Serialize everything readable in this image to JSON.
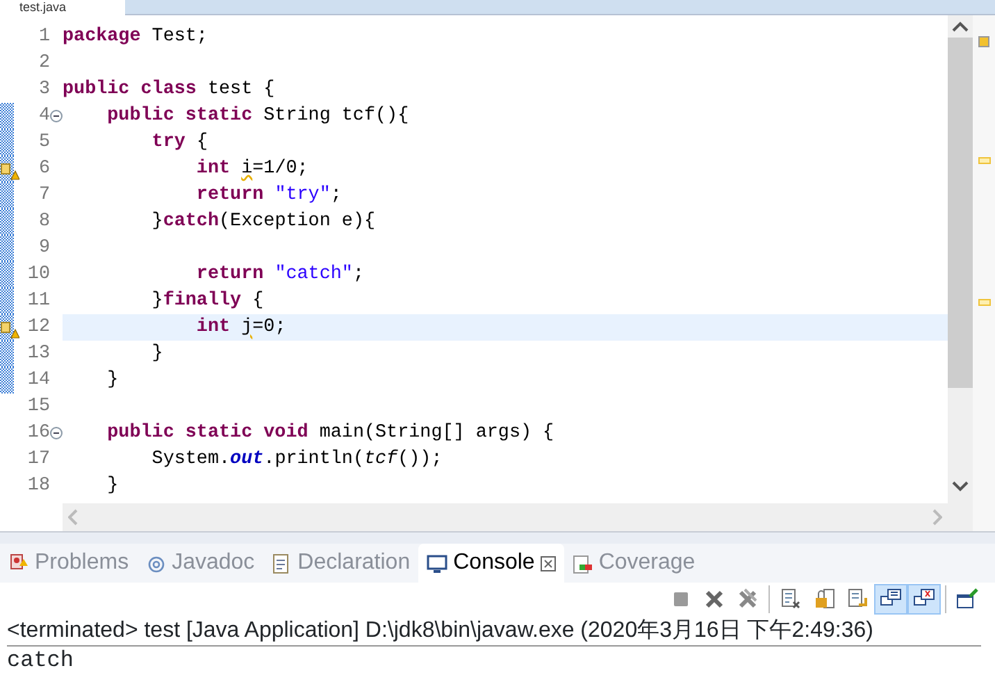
{
  "editor": {
    "tab": {
      "label": "test.java"
    },
    "lines": [
      {
        "number": "1",
        "changed": false,
        "current": false,
        "folding": false,
        "warning": false,
        "tokens": [
          {
            "kind": "kw",
            "text": "package"
          },
          {
            "kind": "plain",
            "text": " Test;"
          }
        ]
      },
      {
        "number": "2",
        "changed": false,
        "current": false,
        "folding": false,
        "warning": false
      },
      {
        "number": "3",
        "changed": false,
        "current": false,
        "folding": false,
        "warning": false,
        "tokens": [
          {
            "kind": "kw",
            "text": "public class"
          },
          {
            "kind": "plain",
            "text": " test {"
          }
        ]
      },
      {
        "number": "4",
        "changed": true,
        "current": false,
        "folding": true,
        "warning": false,
        "tokens": [
          {
            "kind": "kw",
            "text": "    public static"
          },
          {
            "kind": "plain",
            "text": " String tcf(){"
          }
        ]
      },
      {
        "number": "5",
        "changed": true,
        "current": false,
        "folding": false,
        "warning": false,
        "tokens": [
          {
            "kind": "kw",
            "text": "        try"
          },
          {
            "kind": "plain",
            "text": " {"
          }
        ]
      },
      {
        "number": "6",
        "changed": true,
        "current": false,
        "folding": false,
        "warning": true,
        "tokens": [
          {
            "kind": "kw",
            "text": "            int "
          },
          {
            "kind": "warn",
            "text": "i"
          },
          {
            "kind": "plain",
            "text": "=1/0;"
          }
        ]
      },
      {
        "number": "7",
        "changed": true,
        "current": false,
        "folding": false,
        "warning": false,
        "tokens": [
          {
            "kind": "kw",
            "text": "            return "
          },
          {
            "kind": "str",
            "text": "\"try\""
          },
          {
            "kind": "plain",
            "text": ";"
          }
        ]
      },
      {
        "number": "8",
        "changed": true,
        "current": false,
        "folding": false,
        "warning": false,
        "tokens": [
          {
            "kind": "plain",
            "text": "        }"
          },
          {
            "kind": "kw",
            "text": "catch"
          },
          {
            "kind": "plain",
            "text": "(Exception e){"
          }
        ]
      },
      {
        "number": "9",
        "changed": true,
        "current": false,
        "folding": false,
        "warning": false
      },
      {
        "number": "10",
        "changed": true,
        "current": false,
        "folding": false,
        "warning": false,
        "tokens": [
          {
            "kind": "kw",
            "text": "            return "
          },
          {
            "kind": "str",
            "text": "\"catch\""
          },
          {
            "kind": "plain",
            "text": ";"
          }
        ]
      },
      {
        "number": "11",
        "changed": true,
        "current": false,
        "folding": false,
        "warning": false,
        "tokens": [
          {
            "kind": "plain",
            "text": "        }"
          },
          {
            "kind": "kw",
            "text": "finally"
          },
          {
            "kind": "plain",
            "text": " {"
          }
        ]
      },
      {
        "number": "12",
        "changed": true,
        "current": true,
        "folding": false,
        "warning": true,
        "tokens": [
          {
            "kind": "kw",
            "text": "            int "
          },
          {
            "kind": "warn",
            "text": "j"
          },
          {
            "kind": "plain",
            "text": "=0;"
          }
        ]
      },
      {
        "number": "13",
        "changed": true,
        "current": false,
        "folding": false,
        "warning": false,
        "tokens": [
          {
            "kind": "plain",
            "text": "        }"
          }
        ]
      },
      {
        "number": "14",
        "changed": true,
        "current": false,
        "folding": false,
        "warning": false,
        "tokens": [
          {
            "kind": "plain",
            "text": "    }"
          }
        ]
      },
      {
        "number": "15",
        "changed": false,
        "current": false,
        "folding": false,
        "warning": false
      },
      {
        "number": "16",
        "changed": false,
        "current": false,
        "folding": true,
        "warning": false,
        "tokens": [
          {
            "kind": "kw",
            "text": "    public static void"
          },
          {
            "kind": "plain",
            "text": " main(String[] args) {"
          }
        ]
      },
      {
        "number": "17",
        "changed": false,
        "current": false,
        "folding": false,
        "warning": false,
        "tokens": [
          {
            "kind": "plain",
            "text": "        System."
          },
          {
            "kind": "field",
            "text": "out"
          },
          {
            "kind": "plain",
            "text": ".println("
          },
          {
            "kind": "static",
            "text": "tcf"
          },
          {
            "kind": "plain",
            "text": "());"
          }
        ]
      },
      {
        "number": "18",
        "changed": false,
        "current": false,
        "folding": false,
        "warning": false,
        "tokens": [
          {
            "kind": "plain",
            "text": "    }"
          }
        ]
      }
    ]
  },
  "panel": {
    "tabs": [
      {
        "label": "Problems",
        "selected": false
      },
      {
        "label": "Javadoc",
        "selected": false
      },
      {
        "label": "Declaration",
        "selected": false
      },
      {
        "label": "Console",
        "selected": true
      },
      {
        "label": "Coverage",
        "selected": false
      }
    ],
    "toolbar": [
      {
        "kind": "stop",
        "pressed": false
      },
      {
        "kind": "remove",
        "pressed": false
      },
      {
        "kind": "remove-all",
        "pressed": false
      },
      {
        "kind": "sep"
      },
      {
        "kind": "clear",
        "pressed": false
      },
      {
        "kind": "lock",
        "pressed": false
      },
      {
        "kind": "wrap",
        "pressed": false
      },
      {
        "kind": "show-out",
        "pressed": true
      },
      {
        "kind": "show-err",
        "pressed": true
      },
      {
        "kind": "sep"
      },
      {
        "kind": "open",
        "pressed": false
      }
    ],
    "console": {
      "header": "<terminated> test [Java Application] D:\\jdk8\\bin\\javaw.exe (2020年3月16日 下午2:49:36)",
      "output": [
        "catch"
      ]
    }
  }
}
